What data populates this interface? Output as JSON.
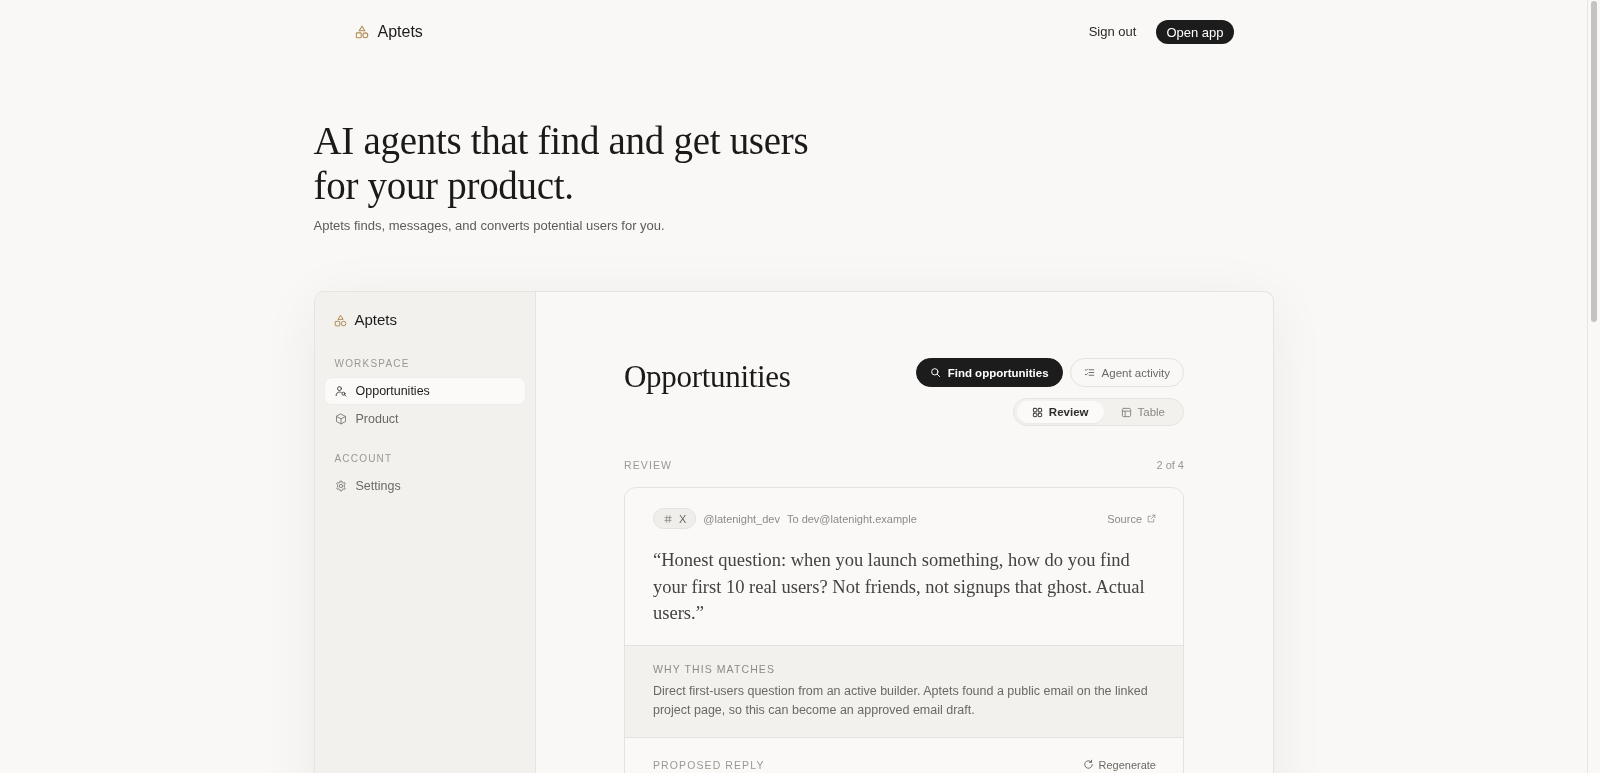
{
  "nav": {
    "brand": "Aptets",
    "links": [
      {
        "kind": "link",
        "label": "Sign out"
      },
      {
        "kind": "button",
        "label": "Open app"
      }
    ]
  },
  "hero": {
    "headline": "AI agents that find and get users for your product.",
    "subtitle": "Aptets finds, messages, and converts potential users for you."
  },
  "app_preview": {
    "sidebar": {
      "brand": "Aptets",
      "sections": [
        {
          "title": "WORKSPACE",
          "items": [
            {
              "label": "Opportunities",
              "selected": true
            },
            {
              "label": "Product",
              "selected": false
            }
          ]
        },
        {
          "title": "ACCOUNT",
          "items": [
            {
              "label": "Settings",
              "selected": false
            }
          ]
        }
      ]
    },
    "main": {
      "title": "Opportunities",
      "actions": [
        {
          "kind": "primary",
          "label": "Find opportunities"
        },
        {
          "kind": "secondary",
          "label": "Agent activity"
        }
      ],
      "view_toggle": [
        {
          "label": "Review",
          "selected": true
        },
        {
          "label": "Table",
          "selected": false
        }
      ],
      "section_label": "REVIEW",
      "counter": "2 of 4",
      "card": {
        "channel": "X",
        "handle": "@latenight_dev",
        "recipient": "To dev@latenight.example",
        "source_link": "Source",
        "quote": "“Honest question: when you launch something, how do you find your first 10 real users? Not friends, not signups that ghost. Actual users.”",
        "why_label": "WHY THIS MATCHES",
        "why_text": "Direct first-users question from an active builder. Aptets found a public email on the linked project page, so this can become an approved email draft.",
        "reply_label": "PROPOSED REPLY",
        "regenerate_label": "Regenerate"
      }
    }
  }
}
